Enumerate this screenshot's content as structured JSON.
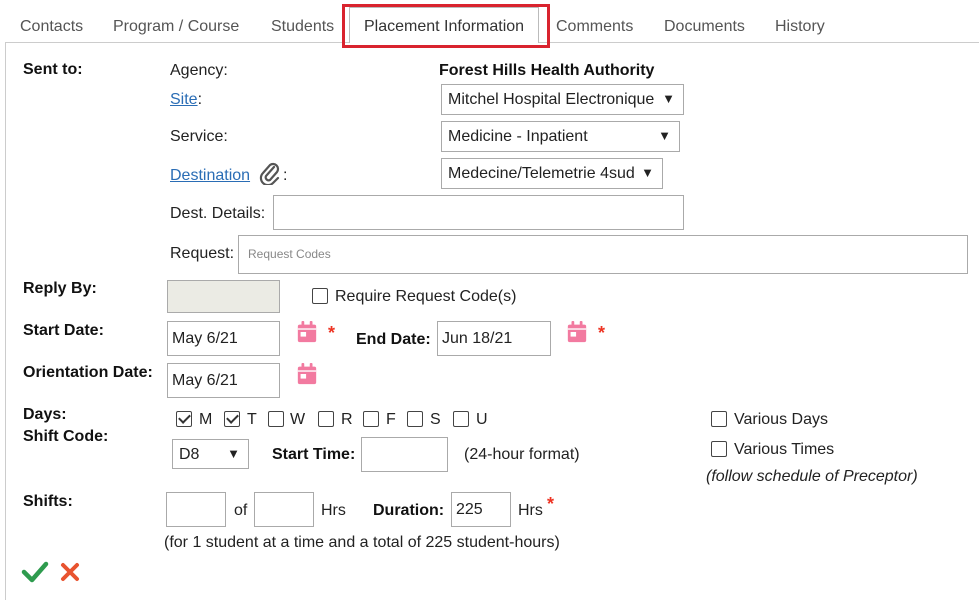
{
  "tabs": [
    {
      "label": "Contacts"
    },
    {
      "label": "Program / Course"
    },
    {
      "label": "Students"
    },
    {
      "label": "Placement Information"
    },
    {
      "label": "Comments"
    },
    {
      "label": "Documents"
    },
    {
      "label": "History"
    }
  ],
  "sent_to": {
    "label": "Sent to",
    "agency_label": "Agency:",
    "agency_value": "Forest Hills Health Authority",
    "site_label": "Site",
    "site_value": "Mitchel Hospital Electronique",
    "service_label": "Service:",
    "service_value": "Medicine - Inpatient",
    "destination_label": "Destination",
    "destination_value": "Medecine/Telemetrie 4sud",
    "dest_details_label": "Dest. Details:",
    "dest_details_value": "",
    "request_label": "Request:",
    "request_placeholder": "Request Codes"
  },
  "reply_by": {
    "label": "Reply By",
    "value": "",
    "require_label": "Require Request Code(s)",
    "require_checked": false
  },
  "dates": {
    "start_label": "Start Date",
    "start_value": "May 6/21",
    "end_label": "End Date",
    "end_value": "Jun 18/21",
    "orientation_label": "Orientation Date",
    "orientation_value": "May 6/21"
  },
  "days": {
    "label": "Days",
    "items": [
      {
        "label": "M",
        "checked": true
      },
      {
        "label": "T",
        "checked": true
      },
      {
        "label": "W",
        "checked": false
      },
      {
        "label": "R",
        "checked": false
      },
      {
        "label": "F",
        "checked": false
      },
      {
        "label": "S",
        "checked": false
      },
      {
        "label": "U",
        "checked": false
      }
    ],
    "various_days_label": "Various Days",
    "various_times_label": "Various Times",
    "follow_note": "(follow schedule of Preceptor)"
  },
  "shift": {
    "code_label": "Shift Code",
    "code_value": "D8",
    "start_time_label": "Start Time",
    "start_time_value": "",
    "format_note": "(24-hour format)"
  },
  "shifts": {
    "label": "Shifts",
    "count_value": "",
    "of_label": "of",
    "hrs_value": "",
    "hrs_label": "Hrs",
    "duration_label": "Duration",
    "duration_value": "225",
    "duration_unit": "Hrs",
    "note": "(for 1 student at a time and a total of 225 student-hours)"
  },
  "colors": {
    "accent": "#2a6db5",
    "highlight": "#d9232e",
    "calendar": "#f27aa0",
    "confirm": "#2e9b4e",
    "cancel": "#e8532f",
    "required": "#ee3322"
  }
}
